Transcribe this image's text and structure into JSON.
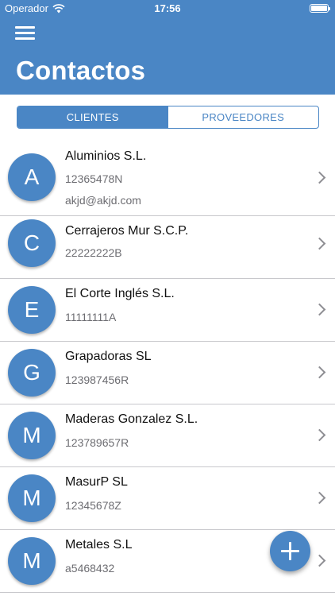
{
  "status_bar": {
    "carrier": "Operador",
    "time": "17:56",
    "wifi_icon": "wifi-icon",
    "battery_icon": "battery-icon"
  },
  "header": {
    "title": "Contactos",
    "menu_icon": "hamburger-menu-icon"
  },
  "tabs": [
    {
      "label": "CLIENTES",
      "active": true
    },
    {
      "label": "PROVEEDORES",
      "active": false
    }
  ],
  "contacts": [
    {
      "initial": "A",
      "name": "Aluminios S.L.",
      "nif": "12365478N",
      "email": "akjd@akjd.com"
    },
    {
      "initial": "C",
      "name": "Cerrajeros Mur S.C.P.",
      "nif": "22222222B"
    },
    {
      "initial": "E",
      "name": "El Corte Inglés S.L.",
      "nif": "11111111A"
    },
    {
      "initial": "G",
      "name": "Grapadoras SL",
      "nif": "123987456R"
    },
    {
      "initial": "M",
      "name": "Maderas Gonzalez S.L.",
      "nif": "123789657R"
    },
    {
      "initial": "M",
      "name": "MasurP SL",
      "nif": "12345678Z"
    },
    {
      "initial": "M",
      "name": "Metales S.L",
      "nif": "a5468432"
    }
  ],
  "fab": {
    "icon": "plus-icon"
  },
  "colors": {
    "accent": "#4a86c5",
    "separator": "#c8c8cc",
    "secondary_text": "#6d6d72"
  }
}
